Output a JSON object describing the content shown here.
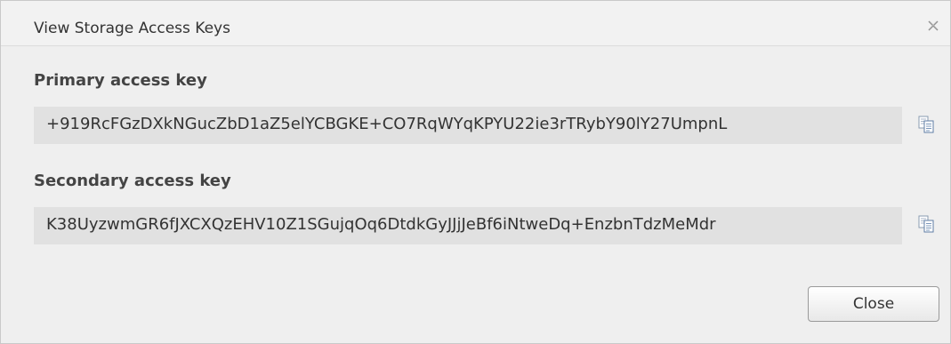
{
  "dialog": {
    "title": "View Storage Access Keys",
    "close_icon": "close-x-icon"
  },
  "primary": {
    "label": "Primary access key",
    "value": "+919RcFGzDXkNGucZbD1aZ5elYCBGKE+CO7RqWYqKPYU22ie3rTRybY90lY27UmpnL",
    "copy_icon": "copy-icon"
  },
  "secondary": {
    "label": "Secondary access key",
    "value": "K38UyzwmGR6fJXCXQzEHV10Z1SGujqOq6DtdkGyJJjJeBf6iNtweDq+EnzbnTdzMeMdr",
    "copy_icon": "copy-icon"
  },
  "footer": {
    "close_label": "Close"
  }
}
